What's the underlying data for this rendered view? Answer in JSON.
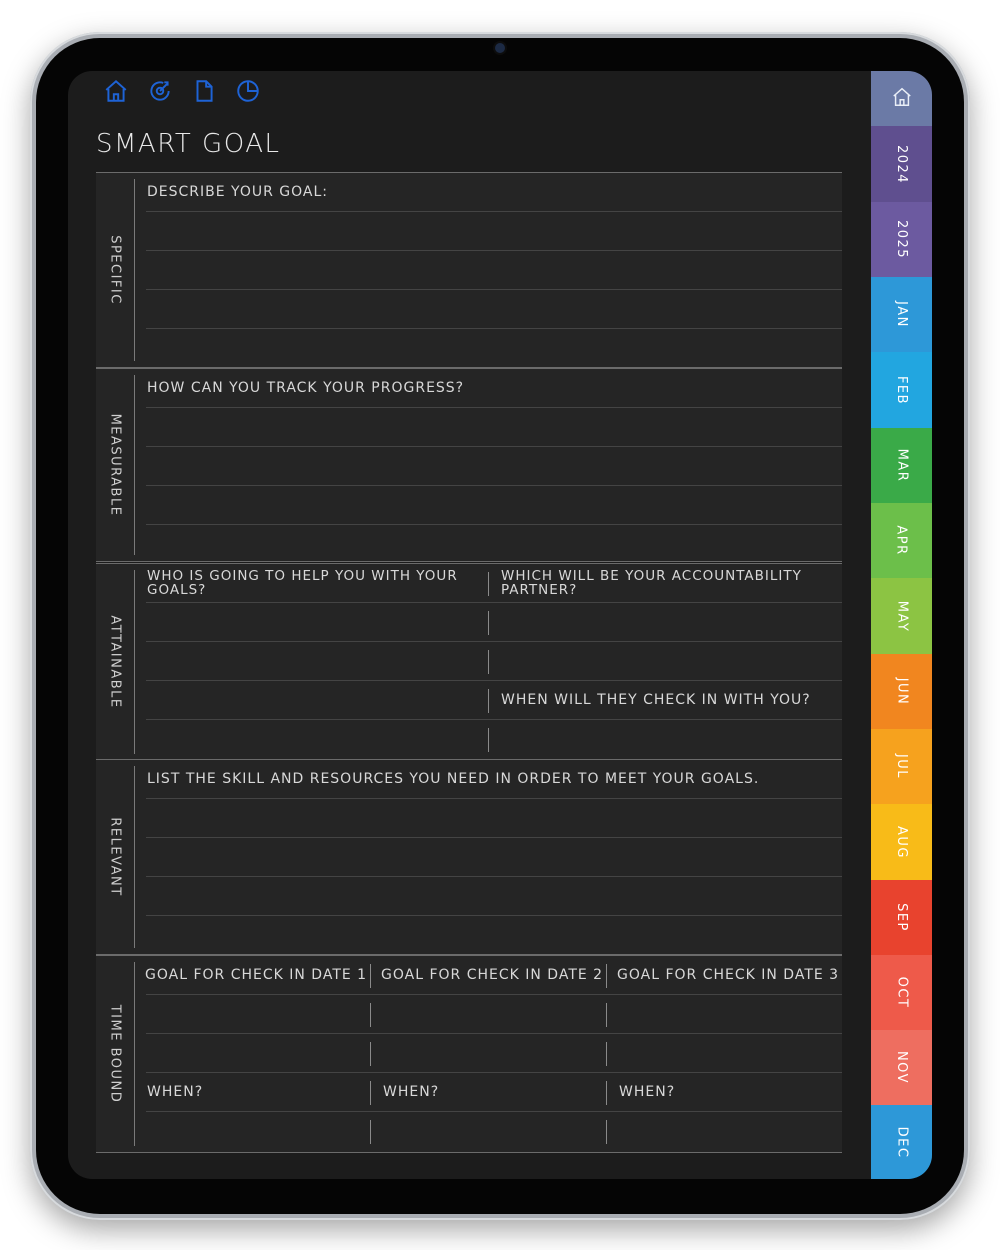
{
  "page": {
    "title": "SMART GOAL"
  },
  "nav_icons": [
    "home-icon",
    "refresh-target-icon",
    "document-icon",
    "pie-chart-icon"
  ],
  "colors": {
    "icon_blue": "#1e63d6",
    "screen_bg": "#1c1c1c",
    "panel_bg": "#252525"
  },
  "sections": {
    "specific": {
      "label": "SPECIFIC",
      "prompt": "DESCRIBE YOUR GOAL:"
    },
    "measurable": {
      "label": "MEASURABLE",
      "prompt": "HOW CAN YOU TRACK YOUR PROGRESS?"
    },
    "attainable": {
      "label": "ATTAINABLE",
      "prompt_left": "WHO IS GOING TO HELP YOU WITH YOUR GOALS?",
      "prompt_right": "WHICH WILL BE YOUR ACCOUNTABILITY PARTNER?",
      "prompt_right_2": "WHEN WILL THEY CHECK IN WITH YOU?"
    },
    "relevant": {
      "label": "RELEVANT",
      "prompt": "LIST THE SKILL AND RESOURCES YOU NEED IN ORDER TO MEET YOUR GOALS."
    },
    "time_bound": {
      "label": "TIME BOUND",
      "columns": [
        "GOAL FOR CHECK IN DATE 1",
        "GOAL FOR CHECK IN DATE 2",
        "GOAL FOR CHECK IN DATE 3"
      ],
      "when": [
        "WHEN?",
        "WHEN?",
        "WHEN?"
      ]
    }
  },
  "tabs": [
    {
      "label": "",
      "icon": "home-icon",
      "color": "#6b7aa6"
    },
    {
      "label": "2024",
      "color": "#5f4f8f"
    },
    {
      "label": "2025",
      "color": "#6c5aa0"
    },
    {
      "label": "JAN",
      "color": "#2d98d8"
    },
    {
      "label": "FEB",
      "color": "#22a6e0"
    },
    {
      "label": "MAR",
      "color": "#3aaa48"
    },
    {
      "label": "APR",
      "color": "#6cbf4a"
    },
    {
      "label": "MAY",
      "color": "#8cc443"
    },
    {
      "label": "JUN",
      "color": "#f1861f"
    },
    {
      "label": "JUL",
      "color": "#f6a21e"
    },
    {
      "label": "AUG",
      "color": "#f8bb18"
    },
    {
      "label": "SEP",
      "color": "#e8432e"
    },
    {
      "label": "OCT",
      "color": "#ee5a4a"
    },
    {
      "label": "NOV",
      "color": "#ee6e60"
    },
    {
      "label": "DEC",
      "color": "#2d98d8"
    }
  ]
}
